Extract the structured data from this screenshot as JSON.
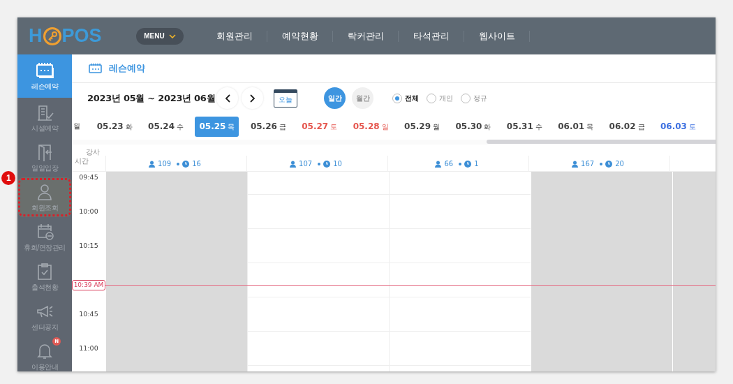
{
  "header": {
    "logo_left": "H",
    "logo_right": "POS",
    "menu_button": "MENU",
    "nav": [
      "회원관리",
      "예약현황",
      "락커관리",
      "타석관리",
      "웹사이트"
    ]
  },
  "sidebar": {
    "items": [
      {
        "label": "레슨예약",
        "selected": true,
        "highlighted": false
      },
      {
        "label": "시설예약",
        "selected": false,
        "highlighted": false
      },
      {
        "label": "일일입장",
        "selected": false,
        "highlighted": false
      },
      {
        "label": "회원조회",
        "selected": false,
        "highlighted": true,
        "callout": "1"
      },
      {
        "label": "휴회/연장관리",
        "selected": false,
        "highlighted": false
      },
      {
        "label": "출석현황",
        "selected": false,
        "highlighted": false
      },
      {
        "label": "센터공지",
        "selected": false,
        "highlighted": false
      },
      {
        "label": "이용안내",
        "selected": false,
        "highlighted": false,
        "badge": "N"
      }
    ]
  },
  "page_title": "레슨예약",
  "toolbar": {
    "range": "2023년 05월 ~ 2023년 06월",
    "today_button": "오늘",
    "view_toggle": [
      {
        "label": "일간",
        "selected": true
      },
      {
        "label": "월간",
        "selected": false
      }
    ],
    "filters": [
      {
        "label": "전체",
        "selected": true
      },
      {
        "label": "개인",
        "selected": false
      },
      {
        "label": "정규",
        "selected": false
      }
    ]
  },
  "dates": [
    {
      "day": "월",
      "kind": "weekday",
      "selected": false
    },
    {
      "date": "05.23",
      "day": "화",
      "kind": "weekday",
      "selected": false
    },
    {
      "date": "05.24",
      "day": "수",
      "kind": "weekday",
      "selected": false
    },
    {
      "date": "05.25",
      "day": "목",
      "kind": "weekday",
      "selected": true
    },
    {
      "date": "05.26",
      "day": "금",
      "kind": "weekday",
      "selected": false
    },
    {
      "date": "05.27",
      "day": "토",
      "kind": "holiday",
      "selected": false
    },
    {
      "date": "05.28",
      "day": "일",
      "kind": "holiday",
      "selected": false
    },
    {
      "date": "05.29",
      "day": "월",
      "kind": "weekday",
      "selected": false
    },
    {
      "date": "05.30",
      "day": "화",
      "kind": "weekday",
      "selected": false
    },
    {
      "date": "05.31",
      "day": "수",
      "kind": "weekday",
      "selected": false
    },
    {
      "date": "06.01",
      "day": "목",
      "kind": "weekday",
      "selected": false
    },
    {
      "date": "06.02",
      "day": "금",
      "kind": "weekday",
      "selected": false
    },
    {
      "date": "06.03",
      "day": "토",
      "kind": "saturday",
      "selected": false
    }
  ],
  "schedule": {
    "corner_top": "강사",
    "corner_bottom": "시간",
    "columns": [
      {
        "members": "109",
        "lessons": "16",
        "closed": true
      },
      {
        "members": "107",
        "lessons": "10",
        "closed": false
      },
      {
        "members": "66",
        "lessons": "1",
        "closed": false
      },
      {
        "members": "167",
        "lessons": "20",
        "closed": true
      },
      {
        "closed": true
      }
    ],
    "slots": [
      {
        "kind": "slot",
        "time": "09:45"
      },
      {
        "kind": "slot",
        "time": "10:00"
      },
      {
        "kind": "slot",
        "time": "10:15"
      },
      {
        "kind": "now",
        "time": "10:39 AM"
      },
      {
        "kind": "slot",
        "time": "10:45"
      },
      {
        "kind": "slot",
        "time": "11:00"
      }
    ]
  }
}
